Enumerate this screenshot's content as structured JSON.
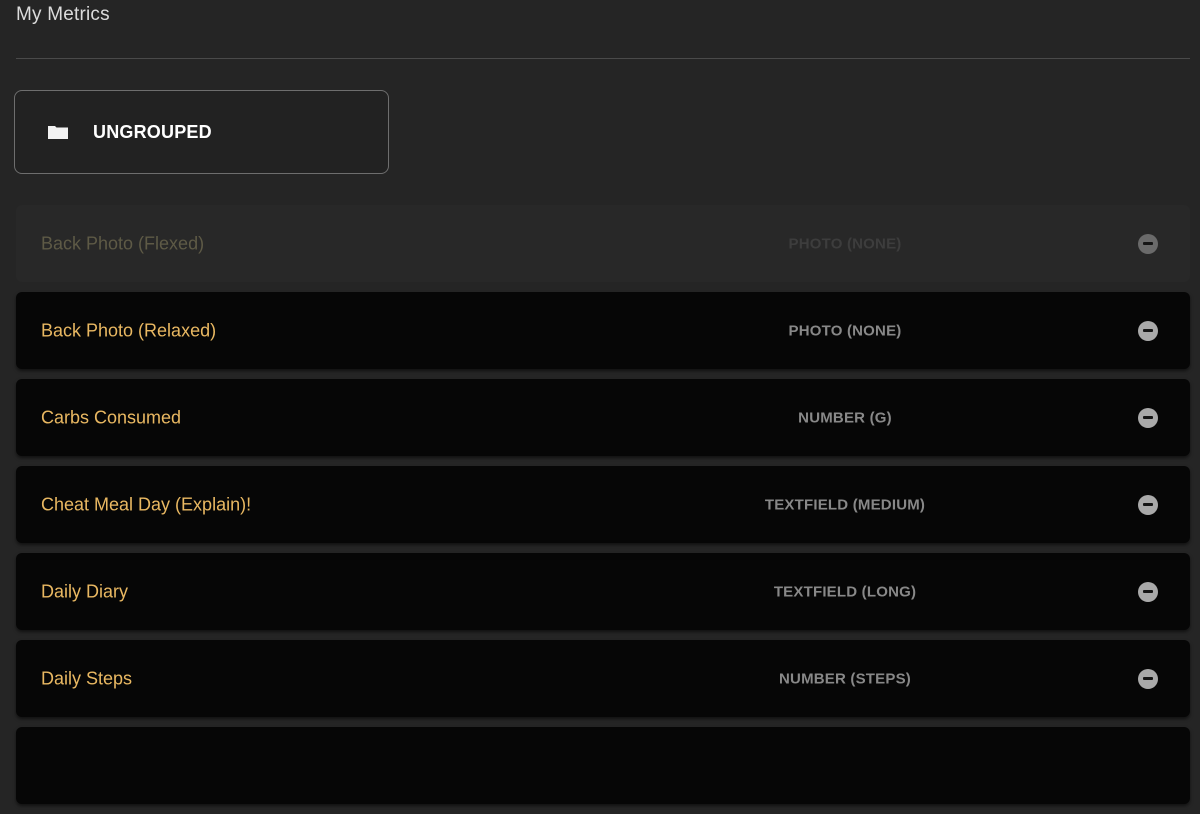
{
  "page": {
    "title": "My Metrics"
  },
  "group": {
    "label": "UNGROUPED",
    "icon": "folder-icon"
  },
  "metrics": [
    {
      "name": "Back Photo (Flexed)",
      "type": "PHOTO (NONE)",
      "state": "dragging"
    },
    {
      "name": "Back Photo (Relaxed)",
      "type": "PHOTO (NONE)"
    },
    {
      "name": "Carbs Consumed",
      "type": "NUMBER (G)"
    },
    {
      "name": "Cheat Meal Day (Explain)!",
      "type": "TEXTFIELD (MEDIUM)"
    },
    {
      "name": "Daily Diary",
      "type": "TEXTFIELD (LONG)"
    },
    {
      "name": "Daily Steps",
      "type": "NUMBER (STEPS)"
    }
  ],
  "colors": {
    "background": "#252525",
    "row_background": "#060606",
    "metric_name": "#e9b862",
    "metric_type": "#888888"
  }
}
